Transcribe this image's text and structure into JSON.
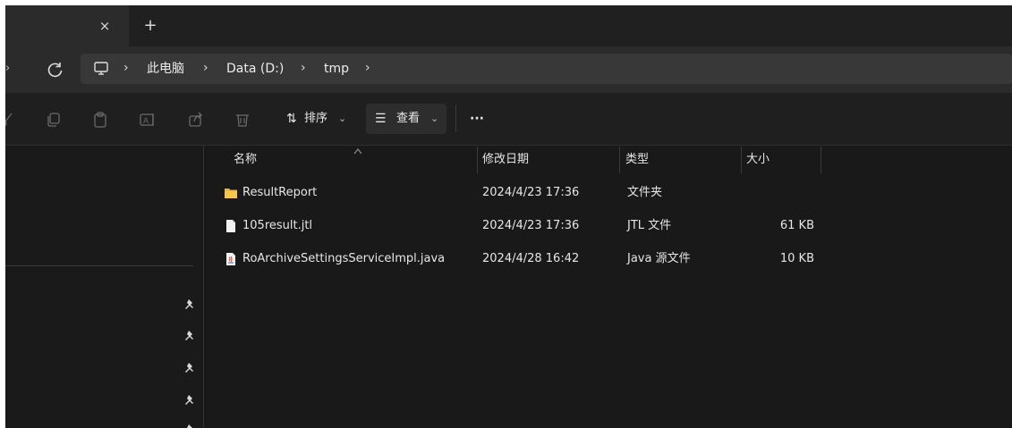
{
  "tabs": {
    "close_glyph": "×",
    "add_glyph": "+"
  },
  "nav": {
    "back_glyph": "›"
  },
  "breadcrumb": {
    "items": [
      "此电脑",
      "Data (D:)",
      "tmp"
    ],
    "separator": "›"
  },
  "toolbar": {
    "sort_label": "排序",
    "view_label": "查看",
    "more_label": "···",
    "dropdown_glyph": "⌄"
  },
  "columns": {
    "name": "名称",
    "modified": "修改日期",
    "type": "类型",
    "size": "大小"
  },
  "files": [
    {
      "name": "ResultReport",
      "modified": "2024/4/23 17:36",
      "type": "文件夹",
      "size": "",
      "icon": "folder-icon"
    },
    {
      "name": "105result.jtl",
      "modified": "2024/4/23 17:36",
      "type": "JTL 文件",
      "size": "61 KB",
      "icon": "file-icon"
    },
    {
      "name": "RoArchiveSettingsServiceImpl.java",
      "modified": "2024/4/28 16:42",
      "type": "Java 源文件",
      "size": "10 KB",
      "icon": "java-file-icon"
    }
  ],
  "colors": {
    "accent_folder": "#f3c33c",
    "background": "#191919",
    "text": "#e6e6e6"
  }
}
